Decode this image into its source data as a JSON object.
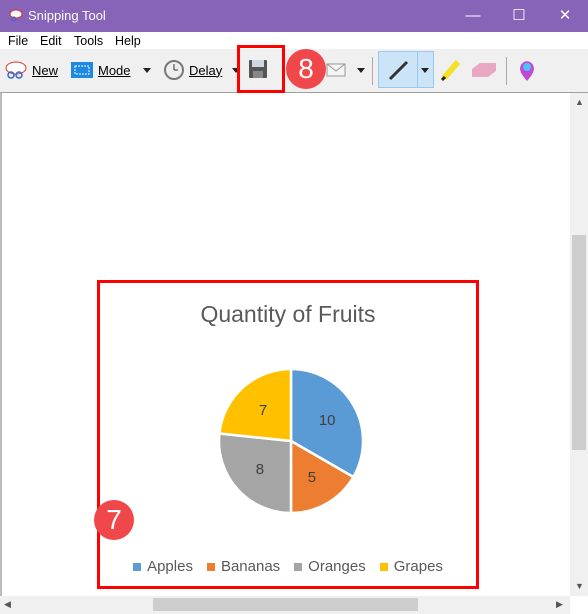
{
  "window": {
    "title": "Snipping Tool",
    "minimize": "—",
    "maximize": "☐",
    "close": "✕"
  },
  "menu": [
    "File",
    "Edit",
    "Tools",
    "Help"
  ],
  "toolbar": {
    "new_label": "New",
    "mode_label": "Mode",
    "delay_label": "Delay"
  },
  "annotations": {
    "save_badge": "8",
    "chart_badge": "7"
  },
  "colors": {
    "titlebar": "#8764b8",
    "highlight": "#ff0000",
    "badge": "#f0484a"
  },
  "chart_data": {
    "type": "pie",
    "title": "Quantity of Fruits",
    "categories": [
      "Apples",
      "Bananas",
      "Oranges",
      "Grapes"
    ],
    "values": [
      10,
      5,
      8,
      7
    ],
    "colors": [
      "#5b9bd5",
      "#ed7d31",
      "#a5a5a5",
      "#ffc000"
    ],
    "data_labels": [
      "10",
      "5",
      "8",
      "7"
    ],
    "legend": "bottom"
  }
}
